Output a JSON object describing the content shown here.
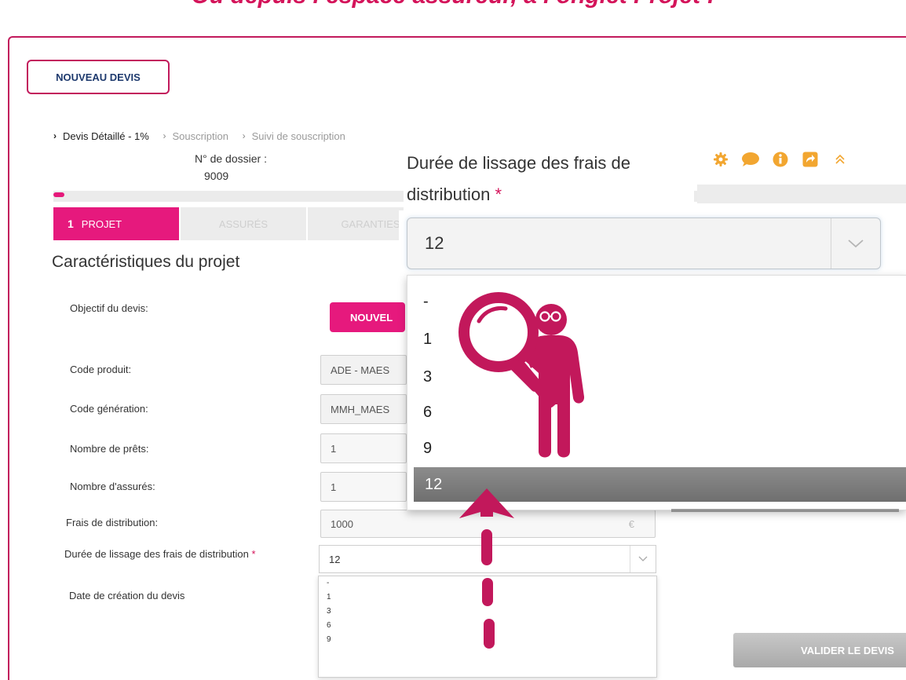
{
  "banner": {
    "title": "Ou depuis l’espace assureur, à l’onglet Projet :"
  },
  "header": {
    "new_quote_button": "NOUVEAU DEVIS",
    "breadcrumb": [
      "Devis Détaillé - 1%",
      "Souscription",
      "Suivi de souscription"
    ],
    "dossier_label": "N° de dossier :",
    "dossier_number": "9009"
  },
  "progress": {
    "percent": 1
  },
  "tabs": [
    {
      "num": "1",
      "label": "PROJET",
      "active": true
    },
    {
      "num": "",
      "label": "ASSURÉS",
      "active": false
    },
    {
      "num": "",
      "label": "GARANTIES",
      "active": false
    }
  ],
  "section_title": "Caractéristiques du projet",
  "form": {
    "objectif_label": "Objectif du devis:",
    "objectif_button": "NOUVEL",
    "code_produit_label": "Code produit:",
    "code_produit_value": "ADE - MAES",
    "code_generation_label": "Code génération:",
    "code_generation_value": "MMH_MAES",
    "nb_prets_label": "Nombre de prêts:",
    "nb_prets_value": "1",
    "nb_assures_label": "Nombre d'assurés:",
    "nb_assures_value": "1",
    "frais_label": "Frais de distribution:",
    "frais_value": "1000",
    "frais_suffix": "€",
    "duree_label": "Durée de lissage des frais de distribution",
    "required_mark": "*",
    "duree_value": "12",
    "date_label": "Date de création du devis",
    "options": [
      "-",
      "1",
      "3",
      "6",
      "9"
    ],
    "validate_button": "VALIDER LE DEVIS"
  },
  "zoom": {
    "heading": "Durée de lissage des frais de distribution",
    "required_mark": "*",
    "selected": "12",
    "options": [
      "-",
      "1",
      "3",
      "6",
      "9",
      "12"
    ]
  },
  "toolbar_icons": [
    "gear-icon",
    "chat-icon",
    "info-icon",
    "share-icon",
    "collapse-icon"
  ],
  "colors": {
    "brand": "#e6197d",
    "title": "#d4145a",
    "frame": "#c21a5c"
  }
}
